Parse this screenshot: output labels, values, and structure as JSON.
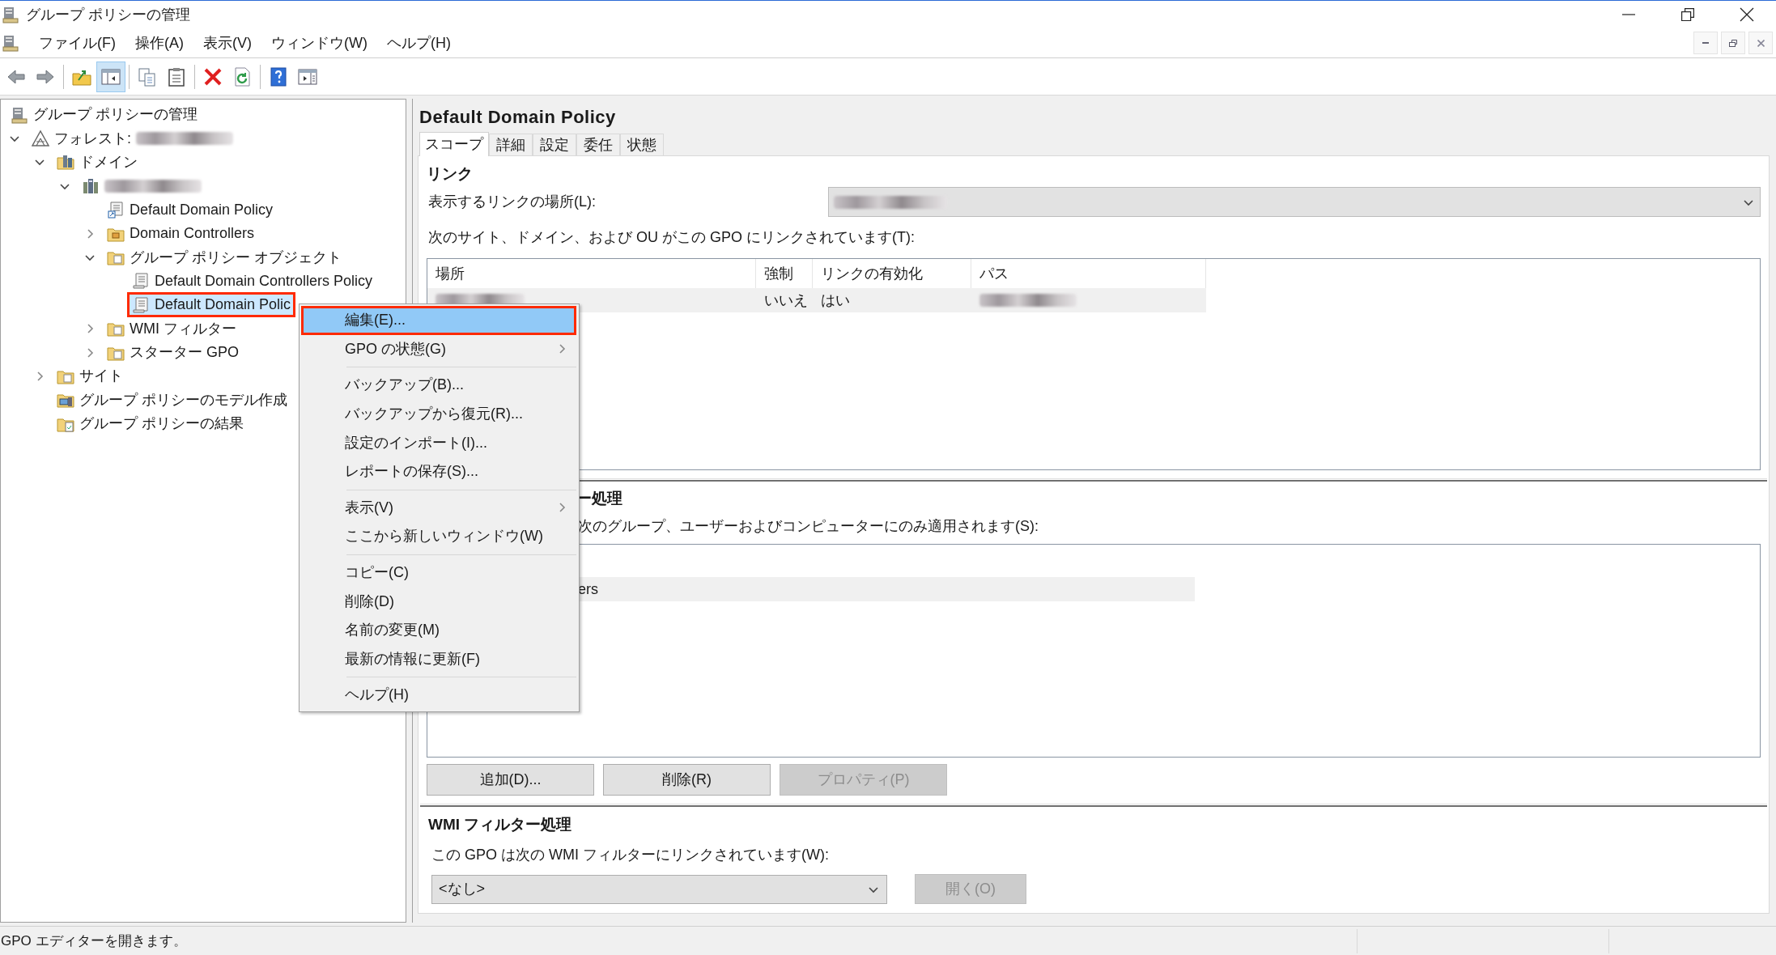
{
  "window": {
    "title": "グループ ポリシーの管理"
  },
  "menu_bar": [
    {
      "label": "ファイル(F)"
    },
    {
      "label": "操作(A)"
    },
    {
      "label": "表示(V)"
    },
    {
      "label": "ウィンドウ(W)"
    },
    {
      "label": "ヘルプ(H)"
    }
  ],
  "toolbar": [
    {
      "kind": "button",
      "pressed": false
    },
    {
      "kind": "button",
      "pressed": false
    },
    {
      "kind": "separator"
    },
    {
      "kind": "button",
      "pressed": false
    },
    {
      "kind": "button",
      "pressed": true
    },
    {
      "kind": "separator"
    },
    {
      "kind": "button",
      "pressed": false
    },
    {
      "kind": "button",
      "pressed": false
    },
    {
      "kind": "separator"
    },
    {
      "kind": "button",
      "pressed": false
    },
    {
      "kind": "button",
      "pressed": false
    },
    {
      "kind": "separator"
    },
    {
      "kind": "button",
      "pressed": false
    },
    {
      "kind": "button",
      "pressed": false
    }
  ],
  "tree": [
    {
      "label": "グループ ポリシーの管理",
      "kind": "console",
      "selected": false,
      "children": [
        {
          "label": "フォレスト:",
          "redacted": true,
          "kind": "forest",
          "selected": false,
          "expanded": true,
          "children": [
            {
              "label": "ドメイン",
              "kind": "domains",
              "selected": false,
              "expanded": true,
              "children": [
                {
                  "redacted": true,
                  "kind": "domain",
                  "selected": false,
                  "expanded": true,
                  "children": [
                    {
                      "label": "Default Domain Policy",
                      "kind": "link",
                      "selected": false
                    },
                    {
                      "label": "Domain Controllers",
                      "kind": "ou",
                      "selected": false,
                      "expanded": false
                    },
                    {
                      "label": "グループ ポリシー オブジェクト",
                      "kind": "folder",
                      "selected": false,
                      "expanded": true,
                      "children": [
                        {
                          "label": "Default Domain Controllers Policy",
                          "kind": "gpo",
                          "selected": false
                        },
                        {
                          "label": "Default Domain Polic",
                          "kind": "gpo",
                          "selected": true,
                          "outlined": true
                        }
                      ]
                    },
                    {
                      "label": "WMI フィルター",
                      "kind": "folder",
                      "selected": false,
                      "expanded": false
                    },
                    {
                      "label": "スターター GPO",
                      "kind": "folder",
                      "selected": false,
                      "expanded": false
                    }
                  ]
                }
              ]
            },
            {
              "label": "サイト",
              "kind": "folder",
              "selected": false,
              "expanded": false
            },
            {
              "label": "グループ ポリシーのモデル作成",
              "kind": "modeling",
              "selected": false
            },
            {
              "label": "グループ ポリシーの結果",
              "kind": "results",
              "selected": false
            }
          ]
        }
      ]
    }
  ],
  "details": {
    "title": "Default Domain Policy",
    "tabs": [
      {
        "label": "スコープ",
        "selected": true
      },
      {
        "label": "詳細",
        "selected": false
      },
      {
        "label": "設定",
        "selected": false
      },
      {
        "label": "委任",
        "selected": false
      },
      {
        "label": "状態",
        "selected": false
      }
    ],
    "links": {
      "heading": "リンク",
      "location_label": "表示するリンクの場所(L):",
      "location_redacted": true,
      "list_label": "次のサイト、ドメイン、および OU がこの GPO にリンクされています(T):",
      "columns": [
        "場所",
        "強制",
        "リンクの有効化",
        "パス"
      ],
      "rows": [
        {
          "selected": false,
          "cells": [
            {
              "redacted": true
            },
            {
              "text": "いいえ"
            },
            {
              "text": "はい"
            },
            {
              "redacted": true
            }
          ]
        }
      ]
    },
    "security": {
      "heading": "ー処理",
      "list_label": "次のグループ、ユーザーおよびコンピューターにのみ適用されます(S):",
      "rows": [
        {
          "text": "ers"
        }
      ],
      "buttons": [
        {
          "label": "追加(D)...",
          "disabled": false
        },
        {
          "label": "削除(R)",
          "disabled": false
        },
        {
          "label": "プロパティ(P)",
          "disabled": true
        }
      ]
    },
    "wmi": {
      "heading": "WMI フィルター処理",
      "label": "この GPO は次の WMI フィルターにリンクされています(W):",
      "value": "<なし>",
      "button": {
        "label": "開く(O)",
        "disabled": true
      }
    }
  },
  "context_menu": [
    {
      "kind": "item",
      "label": "編集(E)...",
      "highlighted": true,
      "outlined": true,
      "submenu": false
    },
    {
      "kind": "item",
      "label": "GPO の状態(G)",
      "highlighted": false,
      "submenu": true
    },
    {
      "kind": "separator"
    },
    {
      "kind": "item",
      "label": "バックアップ(B)...",
      "highlighted": false,
      "submenu": false
    },
    {
      "kind": "item",
      "label": "バックアップから復元(R)...",
      "highlighted": false,
      "submenu": false
    },
    {
      "kind": "item",
      "label": "設定のインポート(I)...",
      "highlighted": false,
      "submenu": false
    },
    {
      "kind": "item",
      "label": "レポートの保存(S)...",
      "highlighted": false,
      "submenu": false
    },
    {
      "kind": "separator"
    },
    {
      "kind": "item",
      "label": "表示(V)",
      "highlighted": false,
      "submenu": true
    },
    {
      "kind": "item",
      "label": "ここから新しいウィンドウ(W)",
      "highlighted": false,
      "submenu": false
    },
    {
      "kind": "separator"
    },
    {
      "kind": "item",
      "label": "コピー(C)",
      "highlighted": false,
      "submenu": false
    },
    {
      "kind": "item",
      "label": "削除(D)",
      "highlighted": false,
      "submenu": false
    },
    {
      "kind": "item",
      "label": "名前の変更(M)",
      "highlighted": false,
      "submenu": false
    },
    {
      "kind": "item",
      "label": "最新の情報に更新(F)",
      "highlighted": false,
      "submenu": false
    },
    {
      "kind": "separator"
    },
    {
      "kind": "item",
      "label": "ヘルプ(H)",
      "highlighted": false,
      "submenu": false
    }
  ],
  "status_bar": {
    "text": "GPO エディターを開きます。"
  }
}
